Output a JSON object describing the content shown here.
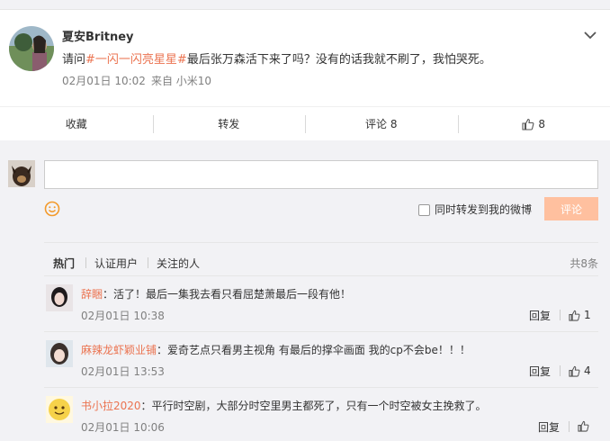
{
  "post": {
    "username": "夏安Britney",
    "text_before": "请问",
    "topic": "#一闪一闪亮星星#",
    "text_after": "最后张万森活下来了吗？没有的话我就不刷了，我怕哭死。",
    "time": "02月01日 10:02",
    "source": "来自 小米10"
  },
  "actions": {
    "favorite": "收藏",
    "repost": "转发",
    "comment": "评论 8",
    "like_count": "8"
  },
  "composer": {
    "repost_label": "同时转发到我的微博",
    "submit": "评论"
  },
  "comments_header": {
    "tabs": [
      "热门",
      "认证用户",
      "关注的人"
    ],
    "total": "共8条"
  },
  "comments": [
    {
      "user": "辞睏",
      "text": "：活了！最后一集我去看只看屈楚萧最后一段有他！",
      "time": "02月01日 10:38",
      "reply": "回复",
      "likes": "1"
    },
    {
      "user": "麻辣龙虾颖业铺",
      "text": "：爱奇艺点只看男主视角 有最后的撑伞画面 我的cp不会be！！！",
      "time": "02月01日 13:53",
      "reply": "回复",
      "likes": "4"
    },
    {
      "user": "书小拉2020",
      "text": "：平行时空剧，大部分时空里男主都死了，只有一个时空被女主挽救了。",
      "time": "02月01日 10:06",
      "reply": "回复",
      "likes": ""
    }
  ],
  "colors": {
    "accent": "#eb7350",
    "submit_disabled": "#ffc09f"
  }
}
